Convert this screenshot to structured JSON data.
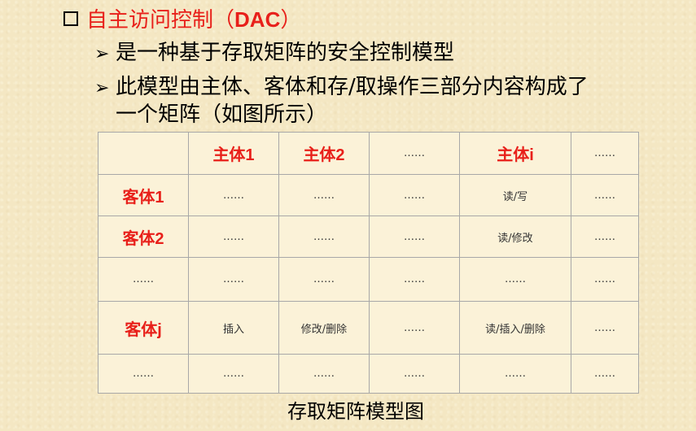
{
  "heading": {
    "prefix": "自主访问控制（",
    "abbr": "DAC",
    "suffix": "）"
  },
  "bullets": [
    "是一种基于存取矩阵的安全控制模型",
    "此模型由主体、客体和存/取操作三部分内容构成了",
    "一个矩阵（如图所示）"
  ],
  "matrix": {
    "header": [
      "",
      "主体1",
      "主体2",
      "……",
      "主体i",
      "……"
    ],
    "rows": [
      [
        "客体1",
        "……",
        "……",
        "……",
        "读/写",
        "……"
      ],
      [
        "客体2",
        "……",
        "……",
        "……",
        "读/修改",
        "……"
      ],
      [
        "……",
        "……",
        "……",
        "……",
        "……",
        "……"
      ],
      [
        "客体j",
        "插入",
        "修改/删除",
        "……",
        "读/插入/删除",
        "……"
      ],
      [
        "……",
        "……",
        "……",
        "……",
        "……",
        "……"
      ]
    ]
  },
  "caption": "存取矩阵模型图",
  "colors": {
    "accent": "#e8201a",
    "background": "#f4e7c3"
  }
}
